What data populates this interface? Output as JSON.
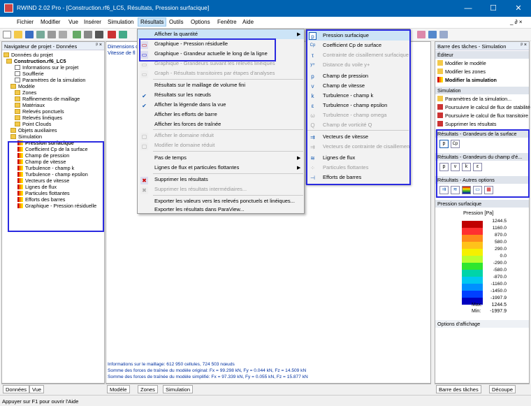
{
  "window": {
    "title": "RWIND 2.02 Pro - [Construction.rf6_LC5, Résultats, Pression surfacique]",
    "min": "—",
    "max": "☐",
    "close": "✕"
  },
  "menubar": [
    "Fichier",
    "Modifier",
    "Vue",
    "Insérer",
    "Simulation",
    "Résultats",
    "Outils",
    "Options",
    "Fenêtre",
    "Aide"
  ],
  "menubar_right": "_ ∂ ×",
  "navigator": {
    "title": "Navigateur de projet - Données",
    "pin": "ᵖ ×",
    "items": [
      "Données du projet",
      "Construction.rf6_LC5",
      "Informations sur le projet",
      "Soufflerie",
      "Paramètres de la simulation",
      "Modèle",
      "Zones",
      "Raffinements de maillage",
      "Matériaux",
      "Relevés ponctuels",
      "Relevés linéiques",
      "Point Clouds",
      "Objets auxiliaires",
      "Simulation",
      "Pression surfacique",
      "Coefficient Cp de la surface",
      "Champ de pression",
      "Champ de vitesse",
      "Turbulence - champ k",
      "Turbulence - champ epsilon",
      "Vecteurs de vitesse",
      "Lignes de flux",
      "Particules flottantes",
      "Efforts des barres",
      "Graphique - Pression résiduelle"
    ],
    "tabs": [
      "Données",
      "Vue"
    ]
  },
  "viewport": {
    "top_lines": [
      "Dimensions d",
      "Vitesse de fl"
    ],
    "info": [
      "Informations sur le maillage: 612 950 cellules, 724 503 nœuds",
      "Somme des forces de traînée du modèle original: Fx = 99.298 kN, Fy = 0.044 kN, Fz = 14.509 kN",
      "Somme des forces de traînée du modèle simplifié: Fx = 97.339 kN, Fy = 0.055 kN, Fz = 15.877 kN"
    ],
    "tabs": [
      "Modèle",
      "Zones",
      "Simulation"
    ]
  },
  "menu_resultats": {
    "items": [
      "Afficher la quantité",
      "Graphique - Pression résiduelle",
      "Graphique - Grandeur actuelle le long de la ligne",
      "Graphique - Grandeurs suivant les relevés linéiques",
      "Graph - Résultats transitoires par étapes d'analyses",
      "Résultats sur le maillage de volume fini",
      "Résultats sur les nœuds",
      "Afficher la légende dans la vue",
      "Afficher les efforts de barre",
      "Afficher les forces de traînée",
      "Afficher le domaine réduit",
      "Modifier le domaine réduit",
      "Pas de temps",
      "Lignes de flux et particules flottantes",
      "Supprimer les résultats",
      "Supprimer les résultats intermédiaires...",
      "Exporter les valeurs vers les relevés ponctuels et linéiques...",
      "Exporter les résultats dans ParaView..."
    ]
  },
  "submenu_quantite": {
    "items": [
      "Pression surfacique",
      "Coefficient Cp de surface",
      "Contrainte de cisaillement surfacique",
      "Distance du voile y+",
      "Champ de pression",
      "Champ de vitesse",
      "Turbulence - champ k",
      "Turbulence - champ epsilon",
      "Turbulence - champ omega",
      "Champ de vorticité Q",
      "Vecteurs de vitesse",
      "Vecteurs de contrainte de cisaillement",
      "Lignes de flux",
      "Particules flottantes",
      "Efforts de barres"
    ],
    "icons": [
      "p",
      "Cp",
      "τ",
      "y+",
      "p",
      "v",
      "k",
      "ε",
      "ω",
      "Q",
      "⇉",
      "⇉",
      "≋",
      "⁘",
      "⊣"
    ]
  },
  "taskpane": {
    "title": "Barre des tâches - Simulation",
    "pin": "ᵖ ×",
    "editor": "Éditeur",
    "editor_items": [
      "Modifier le modèle",
      "Modifier les zones",
      "Modifier la simulation"
    ],
    "simulation": "Simulation",
    "sim_items": [
      "Paramètres de la simulation...",
      "Poursuivre le calcul de flux de stabilité",
      "Poursuivre le calcul de flux transitoire",
      "Supprimer les résultats"
    ],
    "grp1": "Résultats - Grandeurs de la surface",
    "grp2": "Résultats - Grandeurs du champ d'é...",
    "grp3": "Résultats - Autres options",
    "btns1": [
      "p",
      "Cp"
    ],
    "btns2": [
      "p",
      "v",
      "k",
      "ε"
    ],
    "legend_title": "Pression surfacique",
    "legend_unit": "Pression [Pa]",
    "legend_values": [
      "1244.5",
      "1160.0",
      "870.0",
      "580.0",
      "290.0",
      "0.0",
      "-290.0",
      "-580.0",
      "-870.0",
      "-1160.0",
      "-1450.0",
      "-1997.9"
    ],
    "legend_colors": [
      "#c00000",
      "#ff3030",
      "#ff8a1a",
      "#ffc21a",
      "#f5f000",
      "#b8ff2e",
      "#2ee62e",
      "#00d4a8",
      "#00c8f0",
      "#0090ff",
      "#0040ff",
      "#0000c0"
    ],
    "max_label": "Max:",
    "max": "1244.5",
    "min_label": "Min:",
    "min": "-1997.9",
    "display_options": "Options d'affichage",
    "tabs": [
      "Barre des tâches",
      "Découpe"
    ]
  },
  "status": "Appuyer sur F1 pour ouvrir l'Aide"
}
